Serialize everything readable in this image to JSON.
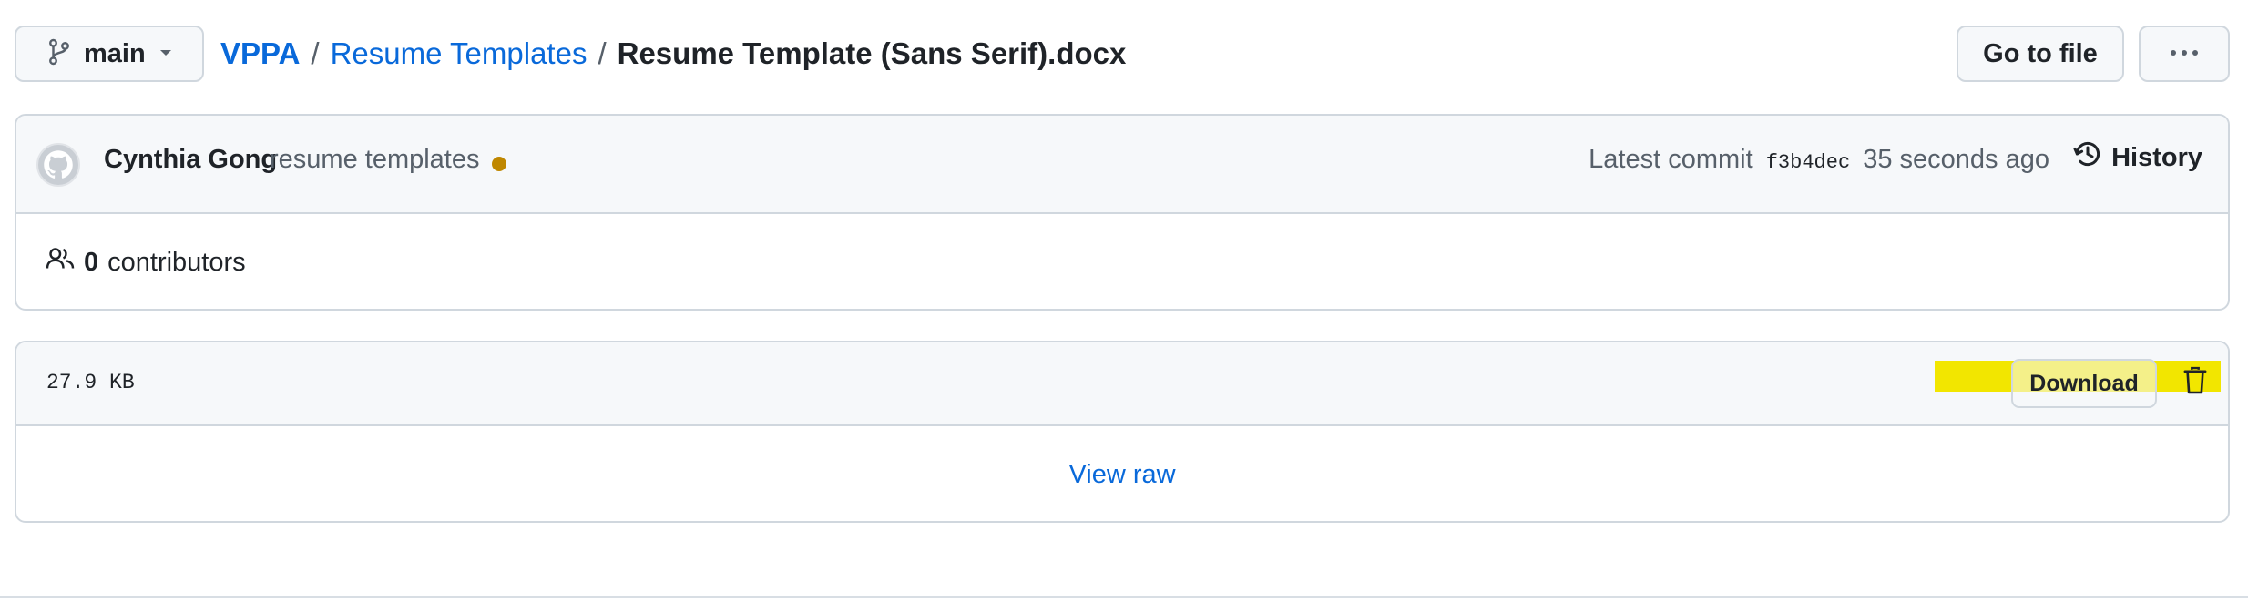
{
  "branch": {
    "label": "main",
    "icon": "git-branch-icon",
    "dropdown_icon": "triangle-down-icon"
  },
  "breadcrumb": {
    "repo": "VPPA",
    "separator_1": "/",
    "folder": "Resume Templates",
    "separator_2": "/",
    "file": "Resume Template (Sans Serif).docx"
  },
  "actions": {
    "go_to_file": "Go to file",
    "more_icon": "kebab-horizontal-icon"
  },
  "commit": {
    "author": "Cynthia Gong",
    "message": "resume templates",
    "status_color": "#bf8700",
    "latest_label": "Latest commit",
    "sha": "f3b4dec",
    "time": "35 seconds ago",
    "history_label": "History",
    "history_icon": "history-icon"
  },
  "contributors": {
    "icon": "people-icon",
    "count": "0",
    "label": "contributors"
  },
  "file": {
    "size": "27.9 KB",
    "download_label": "Download",
    "delete_icon": "trash-icon",
    "view_raw": "View raw",
    "highlight_color": "#f2e600"
  },
  "colors": {
    "link": "#0969da",
    "border": "#d0d7de",
    "header_bg": "#f6f8fa",
    "text": "#1f2328",
    "muted": "#57606a"
  }
}
